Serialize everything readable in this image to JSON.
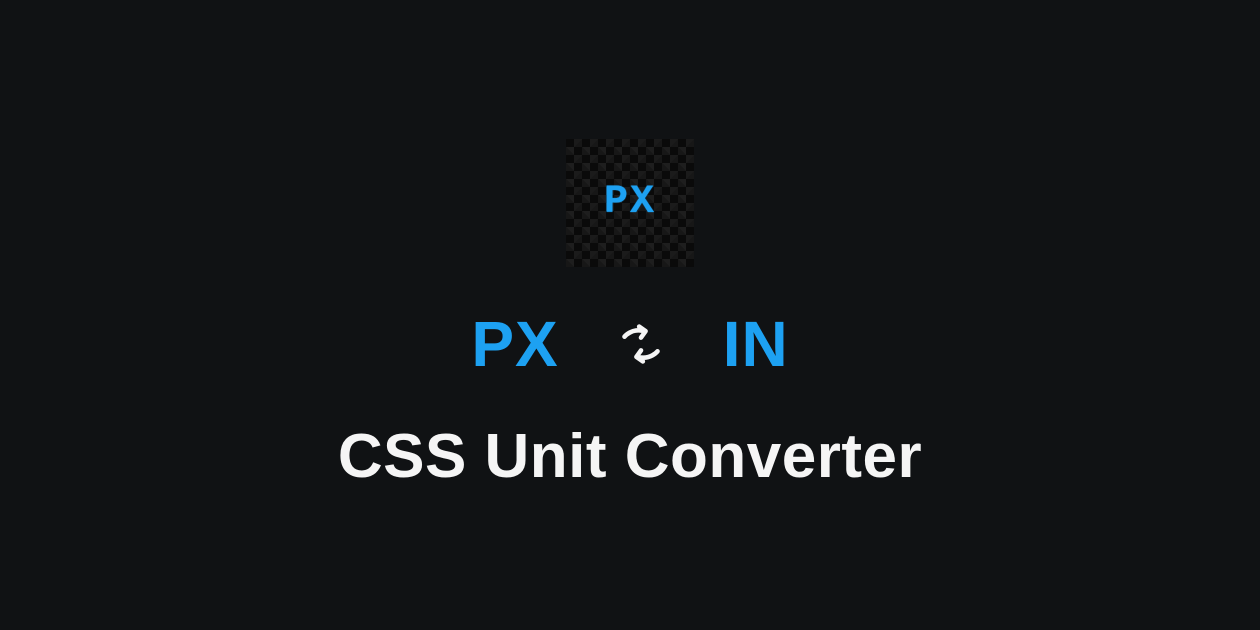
{
  "logo": {
    "text": "PX"
  },
  "converter": {
    "unit_from": "PX",
    "unit_to": "IN"
  },
  "title": "CSS Unit Converter"
}
